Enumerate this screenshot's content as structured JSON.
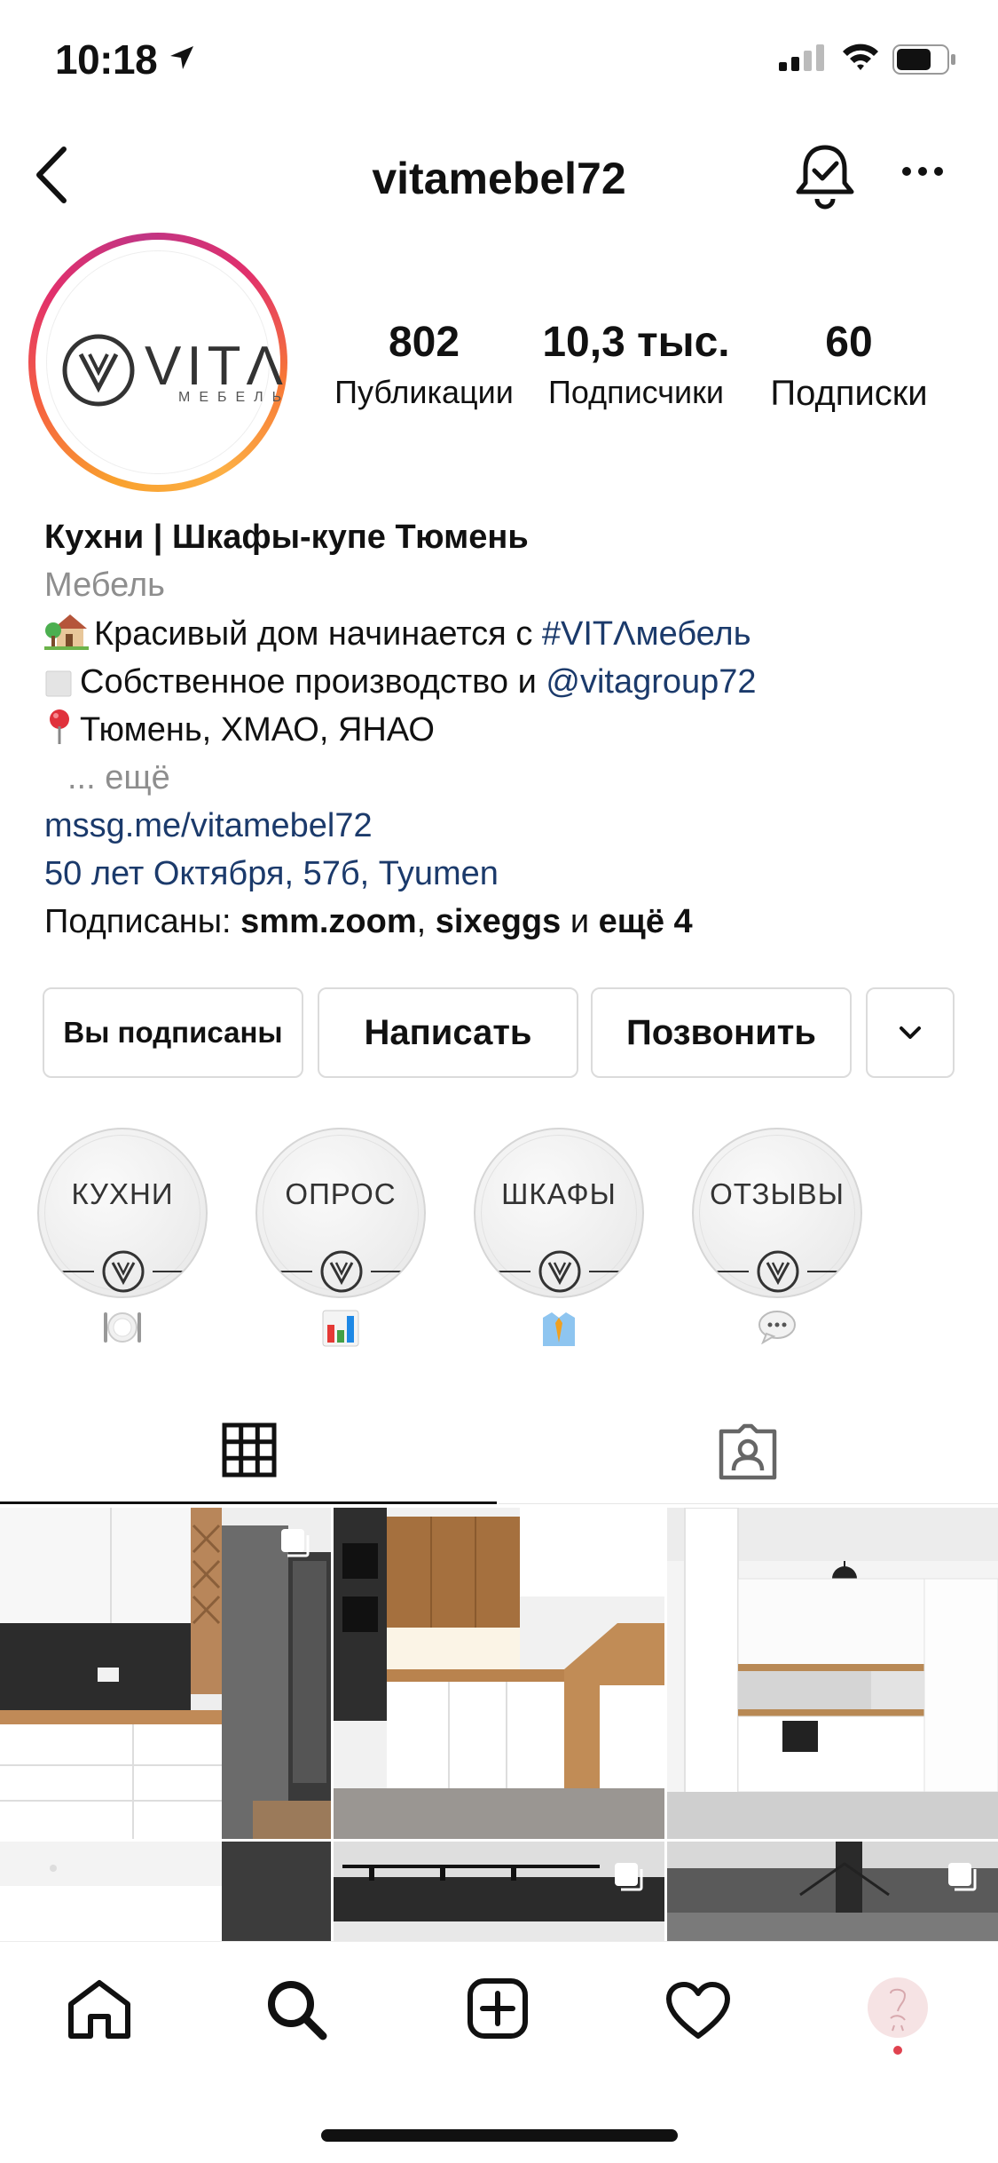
{
  "status_bar": {
    "time": "10:18"
  },
  "header": {
    "username": "vitamebel72"
  },
  "avatar": {
    "logo_text": "VITΛ",
    "logo_sub": "МЕБЕЛЬ"
  },
  "stats": [
    {
      "value": "802",
      "label": "Публикации"
    },
    {
      "value": "10,3 тыс.",
      "label": "Подписчики"
    },
    {
      "value": "60",
      "label": "Подписки"
    }
  ],
  "bio": {
    "name": "Кухни | Шкафы-купе Тюмень",
    "category": "Мебель",
    "line1_text": "Красивый дом начинается с ",
    "line1_tag": "#VITΛмебель",
    "line2_text": "Собственное производство и ",
    "line2_mention": "@vitagroup72",
    "line3_text": "Тюмень, ХМАО, ЯНАО",
    "more": "... ещё",
    "website": "mssg.me/vitamebel72",
    "address": "50 лет Октября, 57б, Tyumen",
    "followed_by_prefix": "Подписаны: ",
    "followed_by_1": "smm.zoom",
    "followed_by_sep": ", ",
    "followed_by_2": "sixeggs",
    "followed_by_and": " и ",
    "followed_by_more": "ещё 4"
  },
  "actions": {
    "following": "Вы подписаны",
    "message": "Написать",
    "call": "Позвонить"
  },
  "highlights": [
    {
      "label": "КУХНИ",
      "emoji": "plate-cutlery-emoji"
    },
    {
      "label": "ОПРОС",
      "emoji": "bar-chart-emoji"
    },
    {
      "label": "ШКАФЫ",
      "emoji": "shirt-tie-emoji"
    },
    {
      "label": "ОТЗЫВЫ",
      "emoji": "speech-bubble-emoji"
    }
  ],
  "tabs": [
    "grid-icon",
    "tagged-icon"
  ],
  "nav": [
    "home-icon",
    "search-icon",
    "create-icon",
    "activity-icon",
    "profile-avatar"
  ]
}
